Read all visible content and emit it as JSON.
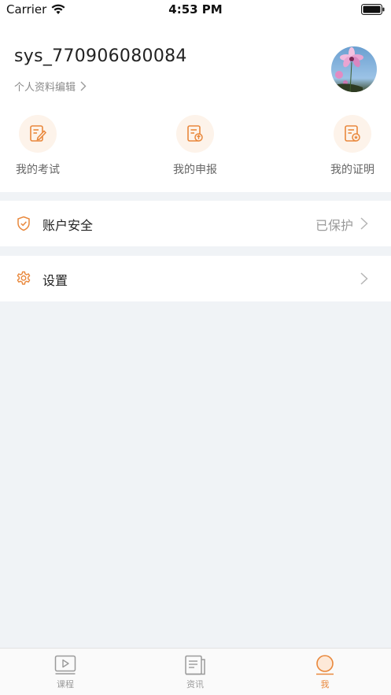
{
  "status_bar": {
    "carrier": "Carrier",
    "time": "4:53 PM"
  },
  "profile": {
    "username": "sys_770906080084",
    "edit_label": "个人资料编辑"
  },
  "quick_actions": [
    {
      "label": "我的考试",
      "icon": "exam-edit-icon"
    },
    {
      "label": "我的申报",
      "icon": "declare-upload-icon"
    },
    {
      "label": "我的证明",
      "icon": "certificate-icon"
    }
  ],
  "menu": {
    "security": {
      "label": "账户安全",
      "value": "已保护",
      "icon": "shield-check-icon"
    },
    "settings": {
      "label": "设置",
      "icon": "gear-icon"
    }
  },
  "tabbar": {
    "items": [
      {
        "label": "课程",
        "icon": "play-video-icon"
      },
      {
        "label": "资讯",
        "icon": "document-icon"
      },
      {
        "label": "我",
        "icon": "profile-icon",
        "active": true
      }
    ]
  },
  "colors": {
    "accent": "#e9883c",
    "background": "#f0f3f6"
  }
}
